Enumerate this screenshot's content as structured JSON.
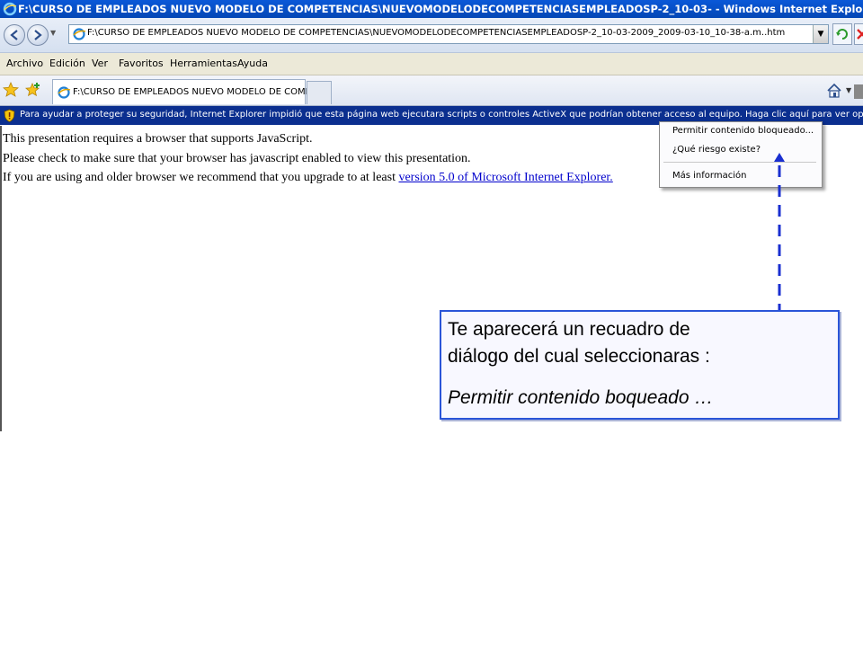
{
  "window": {
    "title": "F:\\CURSO DE EMPLEADOS NUEVO MODELO DE COMPETENCIAS\\NUEVOMODELODECOMPETENCIASEMPLEADOSP-2_10-03- - Windows Internet Explorer"
  },
  "address_bar": {
    "url": "F:\\CURSO DE EMPLEADOS NUEVO MODELO DE COMPETENCIAS\\NUEVOMODELODECOMPETENCIASEMPLEADOSP-2_10-03-2009_2009-03-10_10-38-a.m..htm"
  },
  "menu": {
    "items": [
      "Archivo",
      "Edición",
      "Ver",
      "Favoritos",
      "Herramientas",
      "Ayuda"
    ]
  },
  "tabs": {
    "active_label": "F:\\CURSO DE EMPLEADOS NUEVO MODELO DE COMP..."
  },
  "infobar": {
    "text": "Para ayudar a proteger su seguridad, Internet Explorer impidió que esta página web ejecutara scripts o controles ActiveX que podrían obtener acceso al equipo. Haga clic aquí para ver opciones..."
  },
  "content": {
    "line1": "This presentation requires a browser that supports JavaScript.",
    "line2": "Please check to make sure that your browser has javascript enabled to view this presentation.",
    "line3_prefix": "If you are using and older browser we recommend that you upgrade to at least ",
    "line3_link": "version 5.0 of Microsoft Internet Explorer."
  },
  "context_menu": {
    "items": [
      "Permitir contenido bloqueado...",
      "¿Qué riesgo existe?",
      "Más información"
    ]
  },
  "callout": {
    "line1": "Te aparecerá un recuadro de",
    "line2": "diálogo del cual seleccionaras :",
    "line3": "Permitir contenido boqueado …"
  },
  "colors": {
    "titlebar": "#0447b5",
    "infobar": "#0b2f8f",
    "callout_border": "#2a55d8",
    "pointer": "#1a2fd0",
    "link": "#0000cc"
  }
}
